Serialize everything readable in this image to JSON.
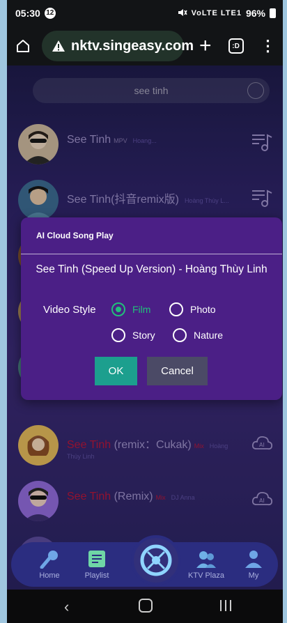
{
  "status": {
    "time": "05:30",
    "notif_count": "12",
    "icons": "VoLTE LTE1",
    "battery": "96%"
  },
  "browser": {
    "url": "nktv.singeasy.com",
    "tabs_label": ":D"
  },
  "search": {
    "value": "see tinh"
  },
  "songs": [
    {
      "title_plain": "See Tinh",
      "tag": "MPV",
      "singer": "Hoang..."
    },
    {
      "title_plain": "See Tinh(抖音remix版)",
      "tag": "",
      "singer": "Hoàng Thùy L..."
    },
    {
      "title_red": "See Tinh",
      "title_plain": " (remix：Cukak)",
      "tag": "Mix",
      "singer": "Hoàng",
      "sub": "Thùy Linh"
    },
    {
      "title_red": "See Tinh",
      "title_plain": " (Remix)",
      "tag": "Mix",
      "singer": "DJ Anna"
    }
  ],
  "dialog": {
    "title": "AI Cloud Song Play",
    "song": "See Tinh (Speed Up Version) - Hoàng Thùy Linh",
    "video_style_label": "Video Style",
    "options": [
      "Film",
      "Photo",
      "Story",
      "Nature"
    ],
    "selected": "Film",
    "ok": "OK",
    "cancel": "Cancel"
  },
  "tabbar": {
    "home": "Home",
    "playlist": "Playlist",
    "ktv_plaza": "KTV Plaza",
    "my": "My"
  },
  "colors": {
    "accent_green": "#21c07a",
    "ok_button": "#1c9f8e",
    "dialog_bg": "#4b1f86",
    "tabbar_bg": "#2b2d80"
  }
}
